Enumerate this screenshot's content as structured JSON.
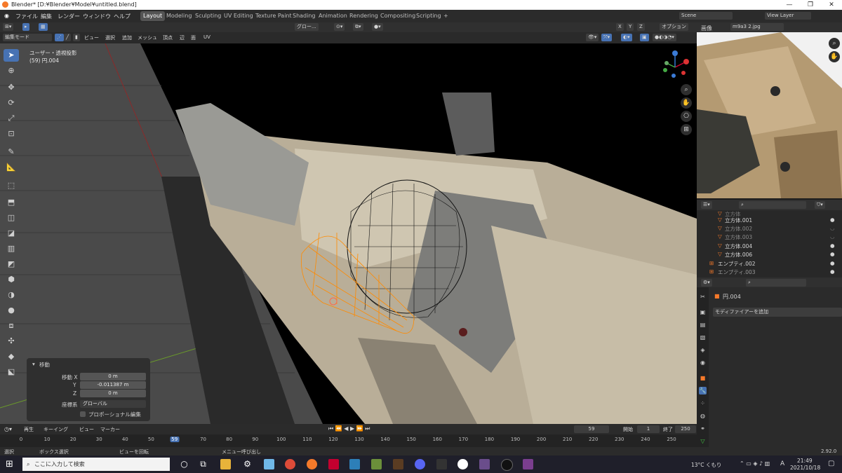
{
  "window": {
    "title": "Blender* [D:¥Blender¥Model¥untitled.blend]"
  },
  "menu": {
    "items": [
      "ファイル",
      "編集",
      "レンダー",
      "ウィンドウ",
      "ヘルプ"
    ]
  },
  "workspaces": {
    "tabs": [
      "Layout",
      "Modeling",
      "Sculpting",
      "UV Editing",
      "Texture Paint",
      "Shading",
      "Animation",
      "Rendering",
      "Compositing",
      "Scripting"
    ],
    "add": "+",
    "active": "Layout"
  },
  "scene": {
    "name": "Scene",
    "view_layer": "View Layer"
  },
  "header": {
    "mode": "編集モード",
    "menus": [
      "ビュー",
      "選択",
      "追加",
      "メッシュ",
      "頂点",
      "辺",
      "面",
      "UV"
    ],
    "transform": "グロー...",
    "axes": [
      "X",
      "Y",
      "Z"
    ],
    "options": "オプション"
  },
  "viewport": {
    "view_name": "ユーザー・透視投影",
    "object_info": "(59) 円.004"
  },
  "operator_panel": {
    "title": "移動",
    "move_x_label": "移動 X",
    "move_x": "0 m",
    "y_label": "Y",
    "move_y": "-0.011387 m",
    "z_label": "Z",
    "move_z": "0 m",
    "orient_label": "座標系",
    "orient_value": "グローバル",
    "proportional": "プロポーショナル編集"
  },
  "timeline_header": {
    "items": [
      "再生",
      "キーイング",
      "ビュー",
      "マーカー"
    ],
    "current": "59",
    "start_label": "開始",
    "start": "1",
    "end_label": "終了",
    "end": "250"
  },
  "timeline": {
    "ticks": [
      "0",
      "10",
      "20",
      "30",
      "40",
      "50",
      "59",
      "70",
      "80",
      "90",
      "100",
      "110",
      "120",
      "130",
      "140",
      "150",
      "160",
      "170",
      "180",
      "190",
      "200",
      "210",
      "220",
      "230",
      "240",
      "250"
    ]
  },
  "statusbar": {
    "items": [
      "選択",
      "ボックス選択",
      "ビューを回転",
      "メニュー呼び出し"
    ],
    "version": "2.92.0"
  },
  "image_editor": {
    "title": "画像",
    "image_name": "m9a3 2.jpg"
  },
  "outliner": {
    "rows": [
      {
        "name": "立方体",
        "visible": false
      },
      {
        "name": "立方体.001",
        "visible": true
      },
      {
        "name": "立方体.002",
        "visible": false
      },
      {
        "name": "立方体.003",
        "visible": false
      },
      {
        "name": "立方体.004",
        "visible": true
      },
      {
        "name": "立方体.006",
        "visible": true
      },
      {
        "name": "エンプティ.002",
        "visible": true
      },
      {
        "name": "エンプティ.003",
        "visible": true
      }
    ]
  },
  "properties": {
    "object": "円.004",
    "add_modifier": "モディファイアーを追加"
  },
  "taskbar": {
    "search": "ここに入力して検索",
    "weather": "13°C くもり",
    "ime": "A",
    "time": "21:49",
    "date": "2021/10/18"
  },
  "colors": {
    "accent": "#4772b3",
    "orange": "#f5792a",
    "selected_edge": "#ff8a00"
  }
}
